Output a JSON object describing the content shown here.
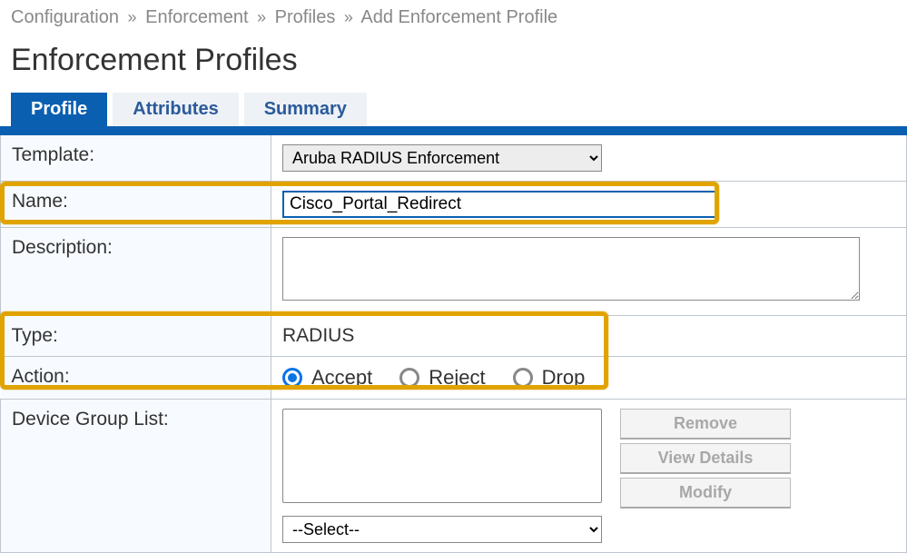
{
  "breadcrumb": {
    "items": [
      "Configuration",
      "Enforcement",
      "Profiles",
      "Add Enforcement Profile"
    ],
    "sep": "»"
  },
  "page_title": "Enforcement Profiles",
  "tabs": [
    {
      "label": "Profile",
      "active": true
    },
    {
      "label": "Attributes",
      "active": false
    },
    {
      "label": "Summary",
      "active": false
    }
  ],
  "form": {
    "template": {
      "label": "Template:",
      "value": "Aruba RADIUS Enforcement"
    },
    "name": {
      "label": "Name:",
      "value": "Cisco_Portal_Redirect"
    },
    "description": {
      "label": "Description:",
      "value": ""
    },
    "type": {
      "label": "Type:",
      "value": "RADIUS"
    },
    "action": {
      "label": "Action:",
      "options": [
        "Accept",
        "Reject",
        "Drop"
      ],
      "selected": "Accept"
    },
    "device_group_list": {
      "label": "Device Group List:",
      "select_placeholder": "--Select--",
      "buttons": {
        "remove": "Remove",
        "view": "View Details",
        "modify": "Modify"
      }
    }
  }
}
